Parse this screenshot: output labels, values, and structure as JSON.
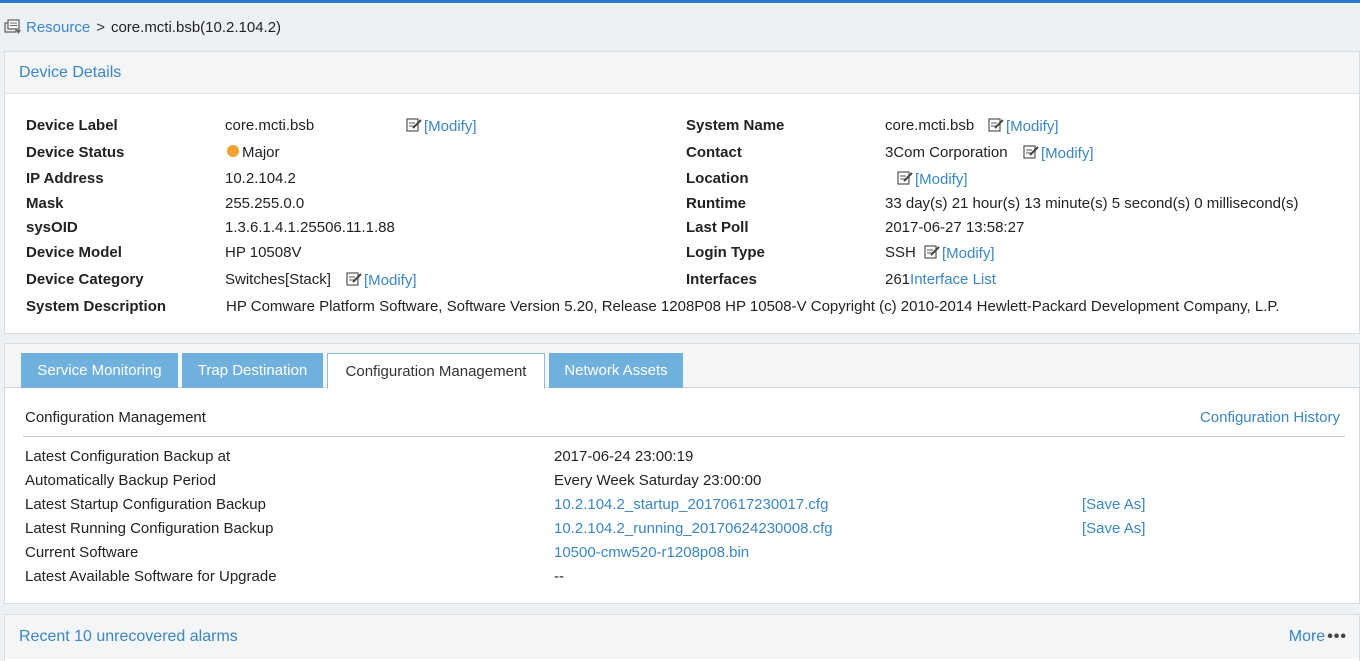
{
  "breadcrumb": {
    "icon": "resource-icon",
    "root": "Resource",
    "separator": ">",
    "current": "core.mcti.bsb(10.2.104.2)"
  },
  "details": {
    "title": "Device Details",
    "modify_label": "[Modify]",
    "left": [
      {
        "key": "Device Label",
        "value": "core.mcti.bsb",
        "modify": true
      },
      {
        "key": "Device Status",
        "value": "Major",
        "status_color": "#f0a030"
      },
      {
        "key": "IP Address",
        "value": "10.2.104.2"
      },
      {
        "key": "Mask",
        "value": "255.255.0.0"
      },
      {
        "key": "sysOID",
        "value": "1.3.6.1.4.1.25506.11.1.88"
      },
      {
        "key": "Device Model",
        "value": "HP 10508V"
      },
      {
        "key": "Device Category",
        "value": "Switches[Stack]",
        "modify": true
      }
    ],
    "right": [
      {
        "key": "System Name",
        "value": "core.mcti.bsb",
        "modify": true
      },
      {
        "key": "Contact",
        "value": "3Com Corporation",
        "modify": true
      },
      {
        "key": "Location",
        "value": "",
        "modify": true
      },
      {
        "key": "Runtime",
        "value": "33 day(s) 21 hour(s) 13 minute(s) 5 second(s) 0 millisecond(s)"
      },
      {
        "key": "Last Poll",
        "value": "2017-06-27 13:58:27"
      },
      {
        "key": "Login Type",
        "value": "SSH",
        "modify": true
      },
      {
        "key": "Interfaces",
        "value": "261",
        "link": "Interface List"
      }
    ],
    "system_description": {
      "key": "System Description",
      "value": "HP Comware Platform Software, Software Version 5.20, Release 1208P08 HP 10508-V Copyright (c) 2010-2014 Hewlett-Packard Development Company, L.P."
    }
  },
  "tabs": [
    {
      "label": "Service Monitoring",
      "active": false
    },
    {
      "label": "Trap Destination",
      "active": false
    },
    {
      "label": "Configuration Management",
      "active": true
    },
    {
      "label": "Network Assets",
      "active": false
    }
  ],
  "config": {
    "title": "Configuration Management",
    "history_link": "Configuration History",
    "rows": [
      {
        "label": "Latest Configuration Backup at",
        "value": "2017-06-24 23:00:19"
      },
      {
        "label": "Automatically Backup Period",
        "value": "Every Week Saturday 23:00:00"
      },
      {
        "label": "Latest Startup Configuration Backup",
        "value": "10.2.104.2_startup_20170617230017.cfg",
        "link": true,
        "action": "[Save As]"
      },
      {
        "label": "Latest Running Configuration Backup",
        "value": "10.2.104.2_running_20170624230008.cfg",
        "link": true,
        "action": "[Save As]"
      },
      {
        "label": "Current Software",
        "value": "10500-cmw520-r1208p08.bin",
        "link": true
      },
      {
        "label": "Latest Available Software for Upgrade",
        "value": "--"
      }
    ]
  },
  "alarms": {
    "title": "Recent 10 unrecovered alarms",
    "more": "More",
    "more_dots": "•••"
  },
  "colors": {
    "accent": "#3a86c6",
    "tab_bg": "#6fb1dc",
    "status_major": "#f0a030",
    "top_bar": "#2b78c5"
  }
}
